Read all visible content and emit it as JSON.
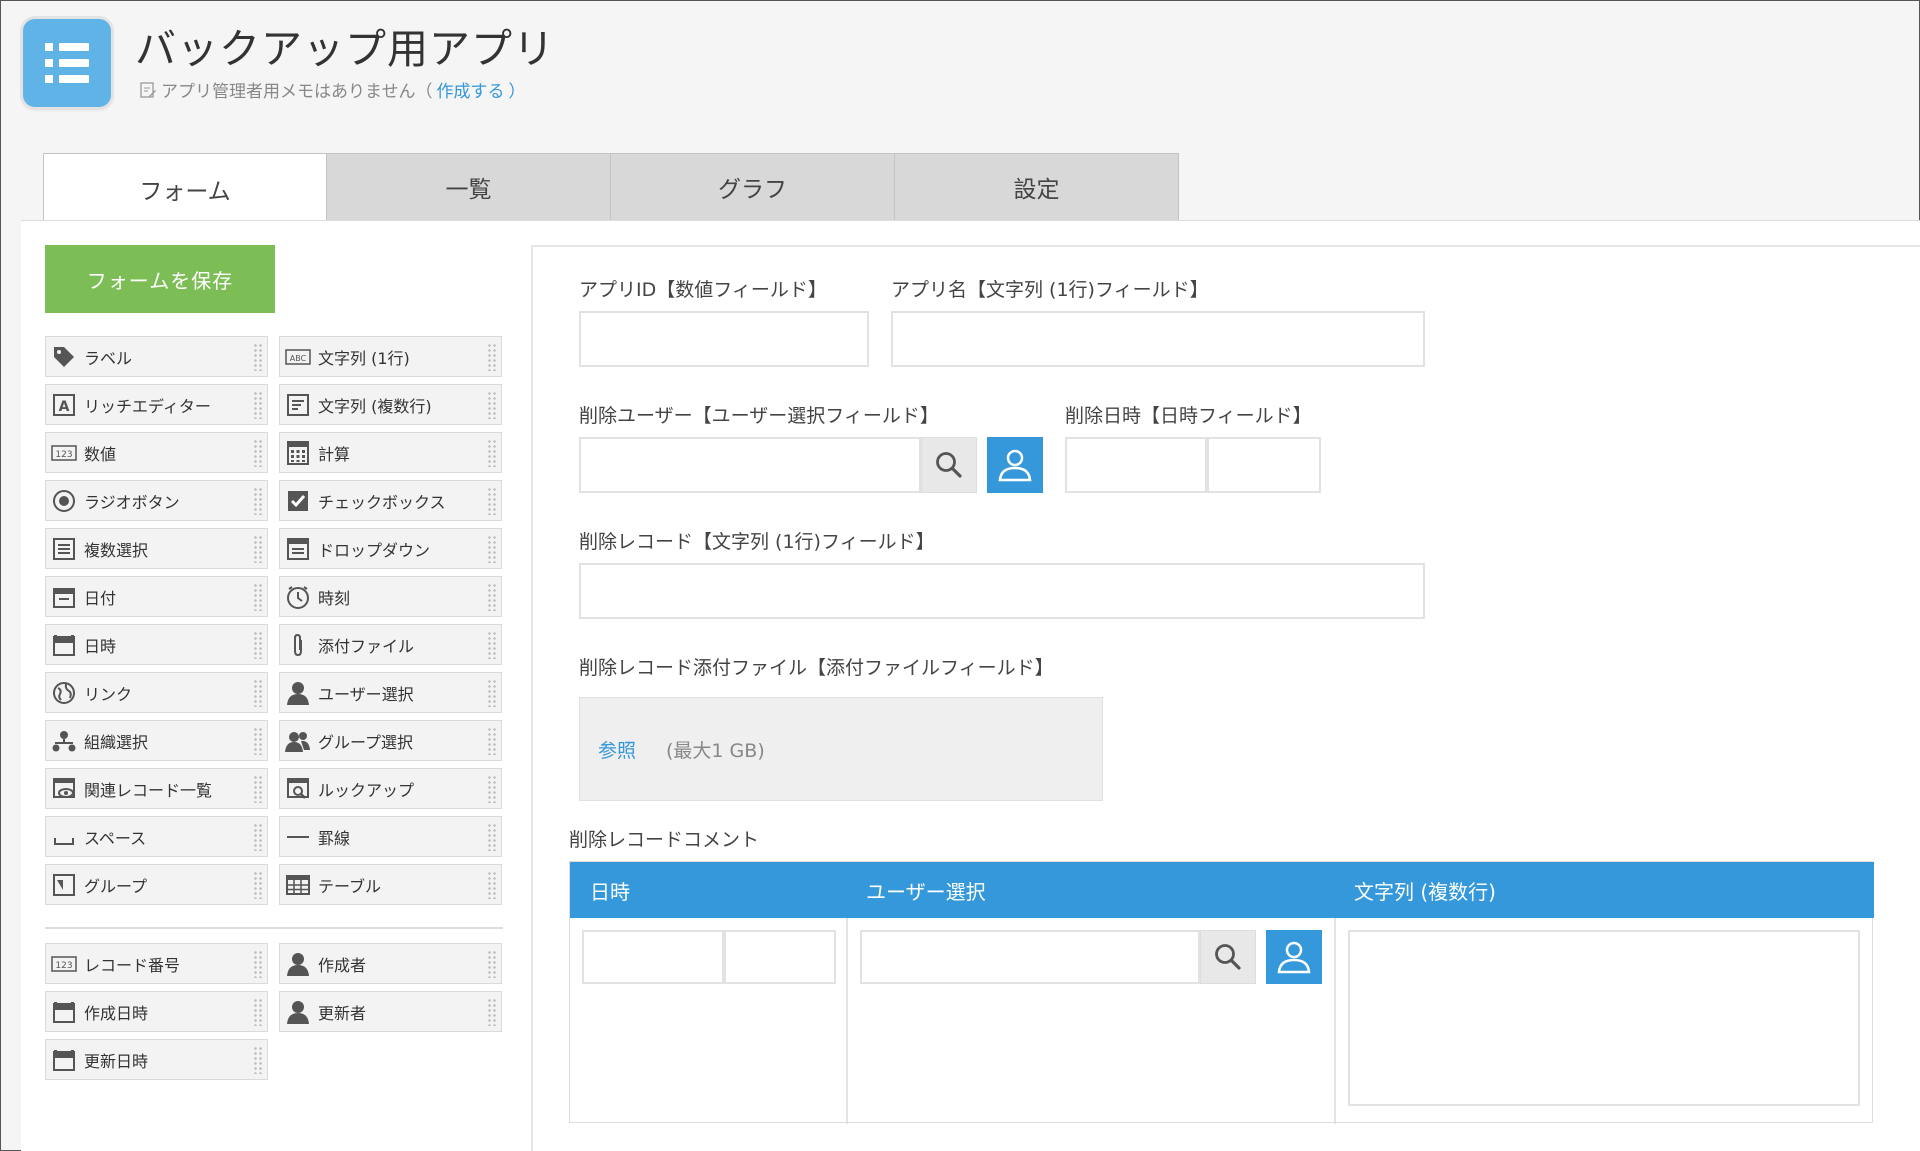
{
  "header": {
    "app_title": "バックアップ用アプリ",
    "memo_text": "アプリ管理者用メモはありません（",
    "memo_link": "作成する",
    "memo_close": "）"
  },
  "tabs": [
    {
      "label": "フォーム",
      "active": true
    },
    {
      "label": "一覧",
      "active": false
    },
    {
      "label": "グラフ",
      "active": false
    },
    {
      "label": "設定",
      "active": false
    }
  ],
  "save_button": "フォームを保存",
  "palette": {
    "left": [
      {
        "label": "ラベル",
        "icon": "tag-icon"
      },
      {
        "label": "リッチエディター",
        "icon": "rich-editor-icon"
      },
      {
        "label": "数値",
        "icon": "number-icon"
      },
      {
        "label": "ラジオボタン",
        "icon": "radio-icon"
      },
      {
        "label": "複数選択",
        "icon": "multi-select-icon"
      },
      {
        "label": "日付",
        "icon": "calendar-icon"
      },
      {
        "label": "日時",
        "icon": "calendar-icon"
      },
      {
        "label": "リンク",
        "icon": "globe-icon"
      },
      {
        "label": "組織選択",
        "icon": "org-icon"
      },
      {
        "label": "関連レコード一覧",
        "icon": "related-records-icon"
      },
      {
        "label": "スペース",
        "icon": "space-icon"
      },
      {
        "label": "グループ",
        "icon": "group-field-icon"
      }
    ],
    "right": [
      {
        "label": "文字列 (1行)",
        "icon": "abc-icon"
      },
      {
        "label": "文字列 (複数行)",
        "icon": "multiline-icon"
      },
      {
        "label": "計算",
        "icon": "calculator-icon"
      },
      {
        "label": "チェックボックス",
        "icon": "checkbox-icon"
      },
      {
        "label": "ドロップダウン",
        "icon": "dropdown-icon"
      },
      {
        "label": "時刻",
        "icon": "clock-icon"
      },
      {
        "label": "添付ファイル",
        "icon": "paperclip-icon"
      },
      {
        "label": "ユーザー選択",
        "icon": "user-icon"
      },
      {
        "label": "グループ選択",
        "icon": "users-icon"
      },
      {
        "label": "ルックアップ",
        "icon": "lookup-icon"
      },
      {
        "label": "罫線",
        "icon": "line-icon"
      },
      {
        "label": "テーブル",
        "icon": "table-icon"
      }
    ],
    "system_left": [
      {
        "label": "レコード番号",
        "icon": "number-icon"
      },
      {
        "label": "作成日時",
        "icon": "calendar-icon"
      },
      {
        "label": "更新日時",
        "icon": "calendar-icon"
      }
    ],
    "system_right": [
      {
        "label": "作成者",
        "icon": "user-icon"
      },
      {
        "label": "更新者",
        "icon": "user-icon"
      }
    ]
  },
  "form": {
    "app_id_label": "アプリID【数値フィールド】",
    "app_name_label": "アプリ名【文字列 (1行)フィールド】",
    "deleted_user_label": "削除ユーザー【ユーザー選択フィールド】",
    "deleted_at_label": "削除日時【日時フィールド】",
    "deleted_record_label": "削除レコード【文字列 (1行)フィールド】",
    "attachment_label": "削除レコード添付ファイル【添付ファイルフィールド】",
    "browse": "参照",
    "max_size": "(最大1 GB)",
    "comment_table_label": "削除レコードコメント",
    "table_headers": [
      "日時",
      "ユーザー選択",
      "文字列 (複数行)"
    ]
  },
  "colors": {
    "accent": "#3498db",
    "save": "#7dbd56",
    "app_icon": "#5fb3e6"
  }
}
